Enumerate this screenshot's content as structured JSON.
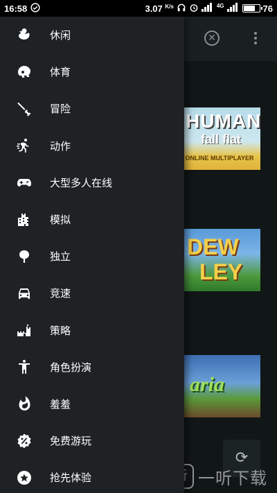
{
  "status_bar": {
    "time": "16:58",
    "speed": "3.07",
    "speed_unit": "K/s",
    "network_label": "4G",
    "battery_pct": "76",
    "battery_level": 0.76
  },
  "background_app": {
    "close_icon": "close-circle-icon",
    "more_icon": "more-vert-icon",
    "cards": [
      {
        "line1": "HUMAN",
        "line2": "fall flat",
        "line3": "ONLINE MULTIPLAYER"
      },
      {
        "line1": "DEW",
        "line2": "LEY"
      },
      {
        "line1": "aria"
      }
    ],
    "refresh_icon": "refresh-icon",
    "watermark": "一听下载",
    "watermark_logo": "听"
  },
  "drawer": {
    "items": [
      {
        "label": "休闲",
        "icon": "duck-icon"
      },
      {
        "label": "体育",
        "icon": "football-helmet-icon"
      },
      {
        "label": "冒险",
        "icon": "sword-icon"
      },
      {
        "label": "动作",
        "icon": "running-man-icon"
      },
      {
        "label": "大型多人在线",
        "icon": "gamepad-icon"
      },
      {
        "label": "模拟",
        "icon": "city-icon"
      },
      {
        "label": "独立",
        "icon": "tree-icon"
      },
      {
        "label": "竞速",
        "icon": "car-icon"
      },
      {
        "label": "策略",
        "icon": "castle-icon"
      },
      {
        "label": "角色扮演",
        "icon": "human-icon"
      },
      {
        "label": "羞羞",
        "icon": "fire-icon"
      },
      {
        "label": "免费游玩",
        "icon": "percent-badge-icon"
      },
      {
        "label": "抢先体验",
        "icon": "star-circle-icon"
      }
    ]
  }
}
